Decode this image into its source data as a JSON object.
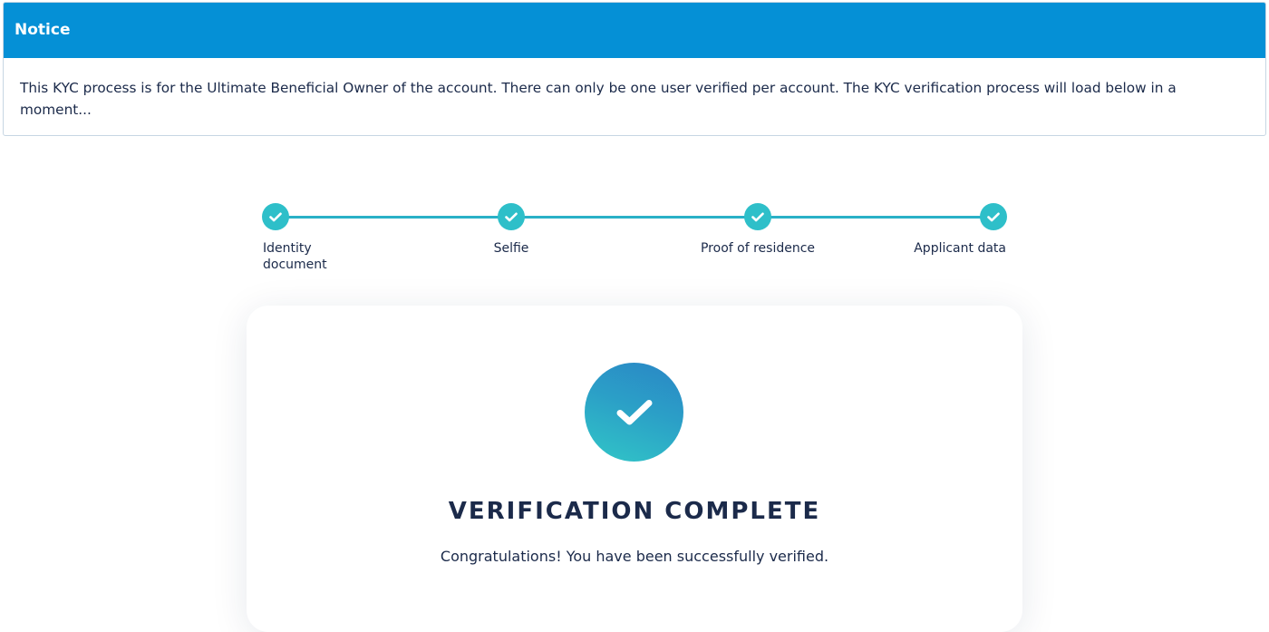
{
  "notice": {
    "title": "Notice",
    "message": "This KYC process is for the Ultimate Beneficial Owner of the account. There can only be one user verified per account. The KYC verification process will load below in a moment..."
  },
  "stepper": {
    "steps": [
      {
        "label": "Identity document",
        "status": "complete",
        "icon": "check-icon"
      },
      {
        "label": "Selfie",
        "status": "complete",
        "icon": "check-icon"
      },
      {
        "label": "Proof of residence",
        "status": "complete",
        "icon": "check-icon"
      },
      {
        "label": "Applicant data",
        "status": "complete",
        "icon": "check-icon"
      }
    ]
  },
  "result": {
    "icon": "check-circle-icon",
    "title": "VERIFICATION COMPLETE",
    "message": "Congratulations! You have been successfully verified."
  },
  "colors": {
    "notice_header": "#0590d6",
    "step_accent": "#2ebfc9",
    "text_dark": "#1b2a4a"
  }
}
